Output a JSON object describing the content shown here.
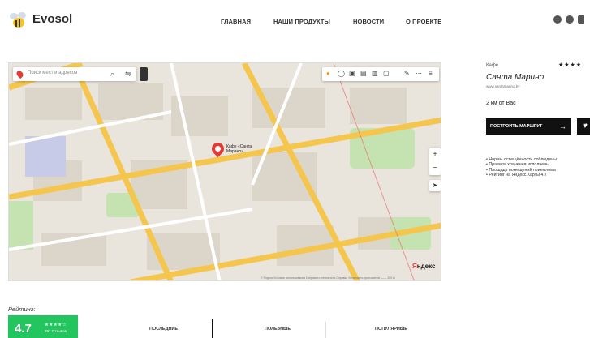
{
  "header": {
    "brand": "Evosol",
    "nav": [
      "ГЛАВНАЯ",
      "НАШИ ПРОДУКТЫ",
      "НОВОСТИ",
      "О ПРОЕКТЕ"
    ],
    "social_icons": [
      "telegram-icon",
      "facebook-icon",
      "instagram-icon"
    ]
  },
  "map": {
    "search_placeholder": "Поиск мест и адресов",
    "marker_label": "Кафе «Санта Марино»",
    "logo_prefix": "Я",
    "logo_rest": "ндекс",
    "footer": "© Яндекс  Условия использования  Исправить неточность  Справка  Установить приложение  ——  200 м"
  },
  "place": {
    "category": "Кафе",
    "stars": "★★★★",
    "name": "Санта Марино",
    "site": "www.santamarino.by",
    "distance": "2 км от Вас",
    "route_label": "ПОСТРОИТЬ МАРШРУТ",
    "features": [
      "• Нормы освещённости соблюдены",
      "• Правила хранения исполнены",
      "• Площадь помещений приемлима",
      "• Рейтинг на Яндекс.Карты 4.7"
    ]
  },
  "rating": {
    "label": "Рейтинг:",
    "value": "4.7",
    "stars": "★★★★☆",
    "reviews": "397 Отзывов"
  },
  "tabs": [
    "ПОСЛЕДНИЕ",
    "ПОЛЕЗНЫЕ",
    "ПОПУЛЯРНЫЕ"
  ],
  "colors": {
    "accent": "#22c55e",
    "marker": "#e53935",
    "dark": "#111111"
  }
}
